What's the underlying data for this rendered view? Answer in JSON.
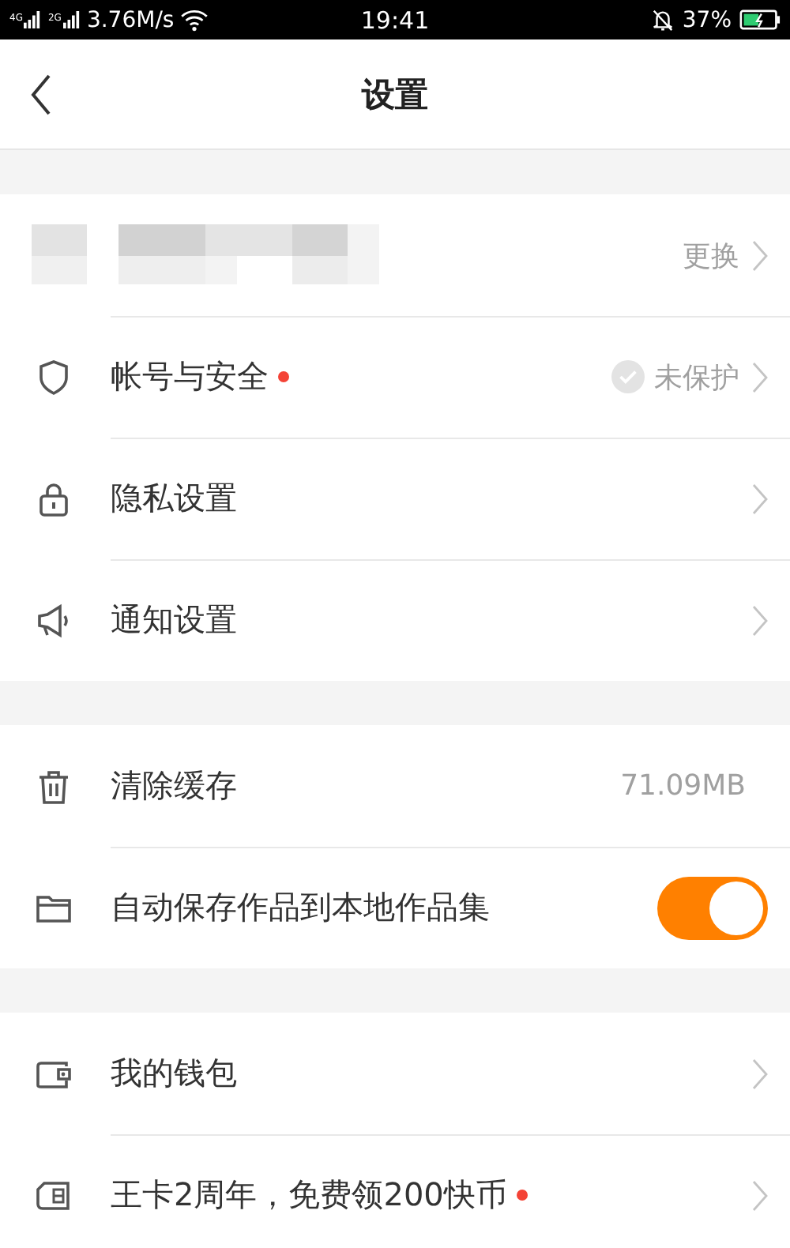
{
  "status_bar": {
    "sim_1": "4G",
    "sim_2": "2G",
    "speed": "3.76M/s",
    "time": "19:41",
    "battery": "37%"
  },
  "header": {
    "title": "设置"
  },
  "groups": [
    {
      "rows": [
        {
          "kind": "account",
          "value": "更换"
        },
        {
          "kind": "link",
          "label": "帐号与安全",
          "dot": true,
          "value": "未保护",
          "verified": false
        },
        {
          "kind": "link",
          "label": "隐私设置",
          "dot": false
        },
        {
          "kind": "link",
          "label": "通知设置",
          "dot": false
        }
      ]
    },
    {
      "rows": [
        {
          "kind": "value",
          "label": "清除缓存",
          "value": "71.09MB"
        },
        {
          "kind": "toggle",
          "label": "自动保存作品到本地作品集",
          "on": true
        }
      ]
    },
    {
      "rows": [
        {
          "kind": "link",
          "label": "我的钱包",
          "dot": false
        },
        {
          "kind": "link",
          "label": "王卡2周年，免费领200快币",
          "dot": true
        }
      ]
    }
  ]
}
